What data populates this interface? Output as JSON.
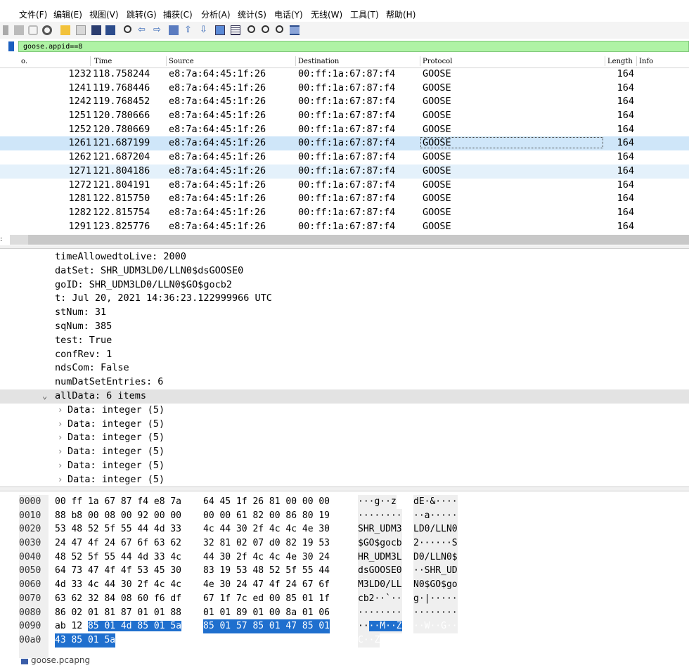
{
  "menu": [
    "文件(F)",
    "编辑(E)",
    "视图(V)",
    "跳转(G)",
    "捕获(C)",
    "分析(A)",
    "统计(S)",
    "电话(Y)",
    "无线(W)",
    "工具(T)",
    "帮助(H)"
  ],
  "toolbar_icons": [
    "shark-fin-icon",
    "stop-icon",
    "restart-icon",
    "options-icon",
    "open-folder-icon",
    "save-icon",
    "close-file-icon",
    "reload-icon",
    "find-icon",
    "back-arrow-icon",
    "forward-arrow-icon",
    "goto-packet-icon",
    "first-packet-icon",
    "last-packet-icon",
    "autoscroll-icon",
    "colorize-icon",
    "zoom-in-icon",
    "zoom-out-icon",
    "normal-size-icon",
    "resize-columns-icon"
  ],
  "filter": {
    "value": "goose.appid==8"
  },
  "packet_list": {
    "columns": [
      "o.",
      "Time",
      "Source",
      "Destination",
      "Protocol",
      "Length",
      "Info"
    ],
    "rows": [
      {
        "no": "1232",
        "time": "118.758244",
        "src": "e8:7a:64:45:1f:26",
        "dst": "00:ff:1a:67:87:f4",
        "proto": "GOOSE",
        "len": "164"
      },
      {
        "no": "1241",
        "time": "119.768446",
        "src": "e8:7a:64:45:1f:26",
        "dst": "00:ff:1a:67:87:f4",
        "proto": "GOOSE",
        "len": "164"
      },
      {
        "no": "1242",
        "time": "119.768452",
        "src": "e8:7a:64:45:1f:26",
        "dst": "00:ff:1a:67:87:f4",
        "proto": "GOOSE",
        "len": "164"
      },
      {
        "no": "1251",
        "time": "120.780666",
        "src": "e8:7a:64:45:1f:26",
        "dst": "00:ff:1a:67:87:f4",
        "proto": "GOOSE",
        "len": "164"
      },
      {
        "no": "1252",
        "time": "120.780669",
        "src": "e8:7a:64:45:1f:26",
        "dst": "00:ff:1a:67:87:f4",
        "proto": "GOOSE",
        "len": "164"
      },
      {
        "no": "1261",
        "time": "121.687199",
        "src": "e8:7a:64:45:1f:26",
        "dst": "00:ff:1a:67:87:f4",
        "proto": "GOOSE",
        "len": "164"
      },
      {
        "no": "1262",
        "time": "121.687204",
        "src": "e8:7a:64:45:1f:26",
        "dst": "00:ff:1a:67:87:f4",
        "proto": "GOOSE",
        "len": "164"
      },
      {
        "no": "1271",
        "time": "121.804186",
        "src": "e8:7a:64:45:1f:26",
        "dst": "00:ff:1a:67:87:f4",
        "proto": "GOOSE",
        "len": "164"
      },
      {
        "no": "1272",
        "time": "121.804191",
        "src": "e8:7a:64:45:1f:26",
        "dst": "00:ff:1a:67:87:f4",
        "proto": "GOOSE",
        "len": "164"
      },
      {
        "no": "1281",
        "time": "122.815750",
        "src": "e8:7a:64:45:1f:26",
        "dst": "00:ff:1a:67:87:f4",
        "proto": "GOOSE",
        "len": "164"
      },
      {
        "no": "1282",
        "time": "122.815754",
        "src": "e8:7a:64:45:1f:26",
        "dst": "00:ff:1a:67:87:f4",
        "proto": "GOOSE",
        "len": "164"
      },
      {
        "no": "1291",
        "time": "123.825776",
        "src": "e8:7a:64:45:1f:26",
        "dst": "00:ff:1a:67:87:f4",
        "proto": "GOOSE",
        "len": "164"
      }
    ]
  },
  "details": [
    "timeAllowedtoLive: 2000",
    "datSet: SHR_UDM3LD0/LLN0$dsGOOSE0",
    "goID: SHR_UDM3LD0/LLN0$GO$gocb2",
    "t: Jul 20, 2021 14:36:23.122999966 UTC",
    "stNum: 31",
    "sqNum: 385",
    "test: True",
    "confRev: 1",
    "ndsCom: False",
    "numDatSetEntries: 6",
    "allData: 6 items",
    "Data: integer (5)",
    "Data: integer (5)",
    "Data: integer (5)",
    "Data: integer (5)",
    "Data: integer (5)",
    "Data: integer (5)"
  ],
  "bytes": [
    {
      "off": "0000",
      "h1": "00 ff 1a 67 87 f4 e8 7a",
      "h2": "64 45 1f 26 81 00 00 00",
      "a1": "···g··z ",
      "a2": "dE·&····"
    },
    {
      "off": "0010",
      "h1": "88 b8 00 08 00 92 00 00",
      "h2": "00 00 61 82 00 86 80 19",
      "a1": "········",
      "a2": "··a·····"
    },
    {
      "off": "0020",
      "h1": "53 48 52 5f 55 44 4d 33",
      "h2": "4c 44 30 2f 4c 4c 4e 30",
      "a1": "SHR_UDM3",
      "a2": "LD0/LLN0"
    },
    {
      "off": "0030",
      "h1": "24 47 4f 24 67 6f 63 62",
      "h2": "32 81 02 07 d0 82 19 53",
      "a1": "$GO$gocb",
      "a2": "2······S"
    },
    {
      "off": "0040",
      "h1": "48 52 5f 55 44 4d 33 4c",
      "h2": "44 30 2f 4c 4c 4e 30 24",
      "a1": "HR_UDM3L",
      "a2": "D0/LLN0$"
    },
    {
      "off": "0050",
      "h1": "64 73 47 4f 4f 53 45 30",
      "h2": "83 19 53 48 52 5f 55 44",
      "a1": "dsGOOSE0",
      "a2": "··SHR_UD"
    },
    {
      "off": "0060",
      "h1": "4d 33 4c 44 30 2f 4c 4c",
      "h2": "4e 30 24 47 4f 24 67 6f",
      "a1": "M3LD0/LL",
      "a2": "N0$GO$go"
    },
    {
      "off": "0070",
      "h1": "63 62 32 84 08 60 f6 df",
      "h2": "67 1f 7c ed 00 85 01 1f",
      "a1": "cb2··`··",
      "a2": "g·|·····"
    },
    {
      "off": "0080",
      "h1": "86 02 01 81 87 01 01 88",
      "h2": "01 01 89 01 00 8a 01 06",
      "a1": "········",
      "a2": "········"
    },
    {
      "off": "0090",
      "h1a": "ab 12",
      "h1b": "85 01 4d 85 01 5a",
      "h2": "85 01 57 85 01 47 85 01",
      "a1a": "··",
      "a1b": "··M··Z",
      "a2": "··W··G··"
    },
    {
      "off": "00a0",
      "h1b": "43 85 01 5a",
      "a1b": "C··Z"
    }
  ],
  "status": {
    "file": "goose.pcapng"
  }
}
